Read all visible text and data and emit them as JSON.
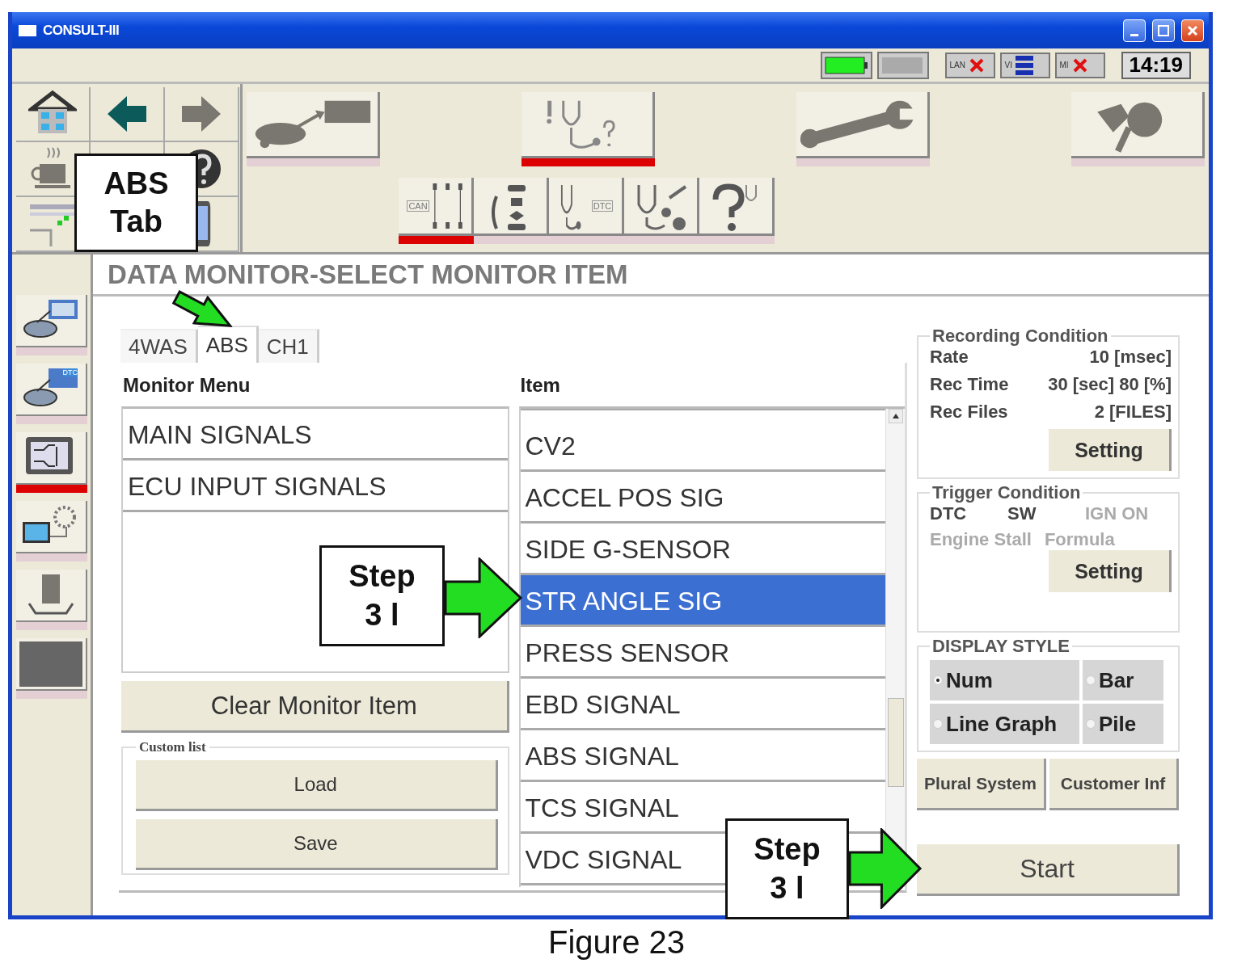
{
  "window": {
    "title": "CONSULT-III"
  },
  "status_bar": {
    "indicators": [
      {
        "label": "LAN",
        "error": true
      },
      {
        "label": "VI",
        "error": false
      },
      {
        "label": "MI",
        "error": true
      }
    ],
    "clock": "14:19"
  },
  "toolbar": {
    "main_buttons": [
      {
        "selected": false
      },
      {
        "selected": true
      },
      {
        "selected": false
      },
      {
        "selected": false
      }
    ],
    "sub_buttons": [
      {
        "label": "CAN",
        "selected": true
      },
      {
        "selected": false
      },
      {
        "label": "DTC",
        "selected": false
      },
      {
        "selected": false
      },
      {
        "selected": false
      }
    ]
  },
  "sidebar": {
    "items": [
      {
        "selected": false
      },
      {
        "label": "DTC",
        "selected": false
      },
      {
        "selected": true
      },
      {
        "selected": false
      },
      {
        "selected": false
      },
      {
        "selected": false
      }
    ]
  },
  "page_title": "DATA MONITOR-SELECT MONITOR ITEM",
  "tabs": [
    {
      "label": "4WAS",
      "selected": false
    },
    {
      "label": "ABS",
      "selected": true
    },
    {
      "label": "CH1",
      "selected": false
    }
  ],
  "monitor_menu": {
    "heading": "Monitor Menu",
    "items": [
      {
        "label": "MAIN SIGNALS",
        "selected": false
      },
      {
        "label": "ECU INPUT SIGNALS",
        "selected": false
      }
    ],
    "clear_button": "Clear Monitor Item",
    "custom_list": {
      "legend": "Custom list",
      "buttons": [
        "Load",
        "Save"
      ]
    }
  },
  "item_list": {
    "heading": "Item",
    "items": [
      {
        "label": "CV2",
        "selected": false
      },
      {
        "label": "ACCEL POS SIG",
        "selected": false
      },
      {
        "label": "SIDE G-SENSOR",
        "selected": false
      },
      {
        "label": "STR ANGLE SIG",
        "selected": true
      },
      {
        "label": "PRESS SENSOR",
        "selected": false
      },
      {
        "label": "EBD SIGNAL",
        "selected": false
      },
      {
        "label": "ABS SIGNAL",
        "selected": false
      },
      {
        "label": "TCS SIGNAL",
        "selected": false
      },
      {
        "label": "VDC SIGNAL",
        "selected": false
      }
    ]
  },
  "recording_condition": {
    "legend": "Recording Condition",
    "rows": [
      {
        "label": "Rate",
        "value": "10 [msec]"
      },
      {
        "label": "Rec Time",
        "value": "30 [sec] 80 [%]"
      },
      {
        "label": "Rec Files",
        "value": "2 [FILES]"
      }
    ],
    "button": "Setting"
  },
  "trigger_condition": {
    "legend": "Trigger Condition",
    "options": [
      {
        "label": "DTC",
        "disabled": false
      },
      {
        "label": "SW",
        "disabled": false
      },
      {
        "label": "IGN ON",
        "disabled": true
      },
      {
        "label": "Engine Stall",
        "disabled": true
      },
      {
        "label": "Formula",
        "disabled": true
      }
    ],
    "button": "Setting"
  },
  "display_style": {
    "legend": "DISPLAY STYLE",
    "options": [
      {
        "label": "Num",
        "selected": true
      },
      {
        "label": "Bar",
        "selected": false
      },
      {
        "label": "Line Graph",
        "selected": false
      },
      {
        "label": "Pile",
        "selected": false
      }
    ]
  },
  "buttons": [
    "Plural System",
    "Customer Inf"
  ],
  "start_button": "Start",
  "callouts": [
    {
      "lines": [
        "ABS",
        "Tab"
      ]
    },
    {
      "lines": [
        "Step",
        "3 l"
      ]
    },
    {
      "lines": [
        "Step",
        "3 l"
      ]
    }
  ],
  "caption": "Figure 23"
}
